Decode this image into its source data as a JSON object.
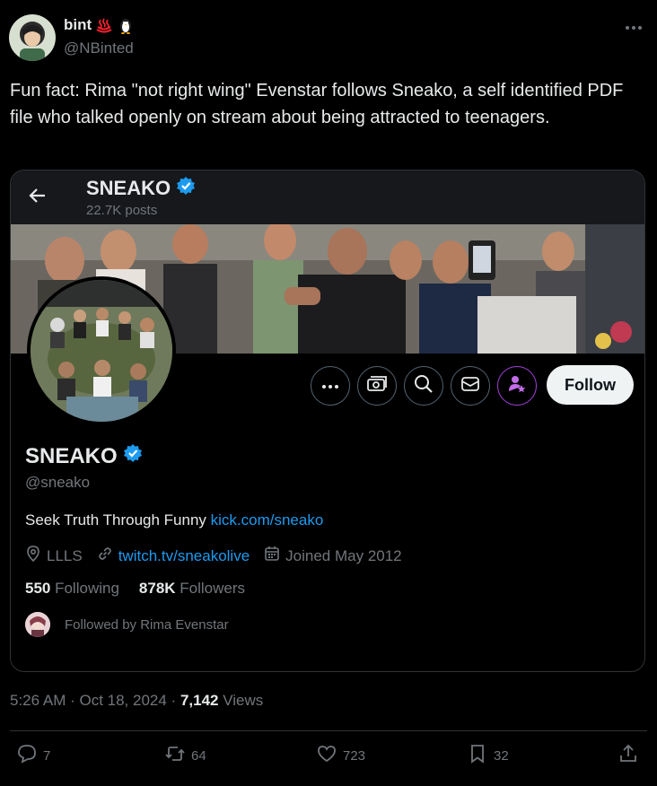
{
  "author": {
    "name": "bint",
    "handle": "@NBinted"
  },
  "tweet": {
    "text": "Fun fact: Rima \"not right wing\" Evenstar follows Sneako, a self identified PDF file who talked openly on stream about being attracted to teenagers.",
    "timestamp": "5:26 AM · Oct 18, 2024 · ",
    "views_count": "7,142",
    "views_label": " Views"
  },
  "profile_card": {
    "header_title": "SNEAKO",
    "posts": "22.7K posts",
    "name": "SNEAKO",
    "handle": "@sneako",
    "bio_text": "Seek Truth Through Funny ",
    "bio_link": "kick.com/sneako",
    "location": "LLLS",
    "website": "twitch.tv/sneakolive",
    "joined": "Joined May 2012",
    "following_count": "550",
    "following_label": " Following",
    "followers_count": "878K",
    "followers_label": " Followers",
    "followed_by": "Followed by Rima Evenstar",
    "follow_button": "Follow"
  },
  "actions": {
    "replies": "7",
    "reposts": "64",
    "likes": "723",
    "bookmarks": "32"
  },
  "colors": {
    "background": "#000000",
    "text": "#e7e9ea",
    "muted": "#71767b",
    "link": "#1d9bf0",
    "verified": "#1d9bf0",
    "subscribe_purple": "#a43fdb"
  },
  "icons": [
    "hot-springs-icon",
    "penguin-icon",
    "more-icon",
    "back-arrow-icon",
    "verified-badge-icon",
    "ellipsis-icon",
    "money-icon",
    "search-icon",
    "message-icon",
    "subscribe-icon",
    "location-icon",
    "link-icon",
    "calendar-icon",
    "reply-icon",
    "repost-icon",
    "like-icon",
    "bookmark-icon",
    "share-icon"
  ]
}
